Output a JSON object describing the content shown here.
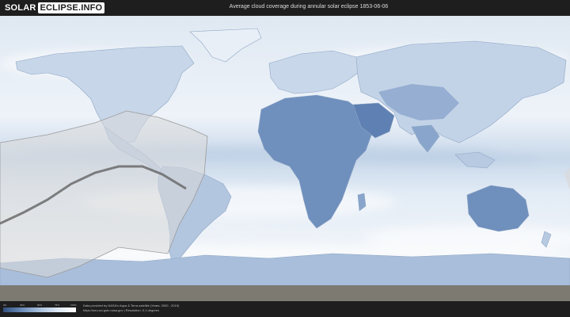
{
  "header": {
    "logo_solar": "SOLAR",
    "logo_rest": "ECLIPSE.INFO",
    "title": "Average cloud coverage during annular solar eclipse 1853-06-06"
  },
  "colors": {
    "ocean_clear": "#e6eef7",
    "cloud_dense": "#ffffff",
    "land_clear": "#6f8fbd",
    "land_deep": "#4a6a9c",
    "path_band": "#d9d9d9",
    "central_line": "#666666",
    "header_bg": "#1e1e1e"
  },
  "legend": {
    "ticks": [
      "0%",
      "25%",
      "50%",
      "75%",
      "100%"
    ]
  },
  "footer": {
    "credit_line_1": "Data provided by NASA's Aqua & Terra satellite (Years: 2000 - 2019)",
    "credit_line_2": "https://neo.sci.gsfc.nasa.gov  |  Resolution: 0.1 degrees"
  },
  "eclipse": {
    "type": "annular",
    "date": "1853-06-06"
  }
}
